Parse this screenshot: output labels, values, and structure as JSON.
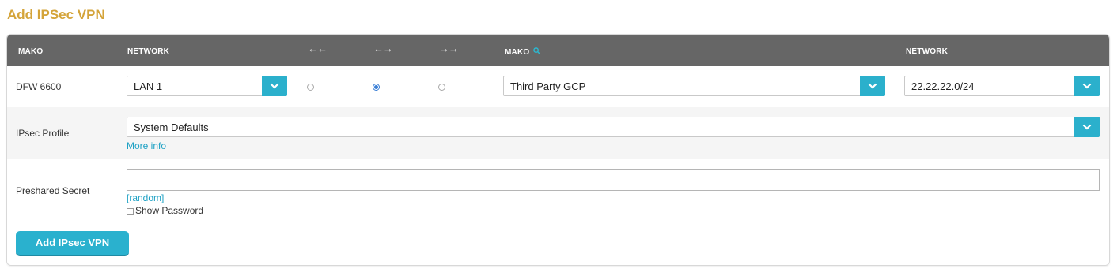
{
  "page": {
    "title": "Add IPSec VPN"
  },
  "table_header": {
    "col_mako": "MAKO",
    "col_network": "NETWORK",
    "dir_left": "←←",
    "dir_both": "←→",
    "dir_right": "→→",
    "col_remote_mako": "MAKO",
    "col_remote_network": "NETWORK",
    "icons": {
      "search": "search-icon"
    }
  },
  "tunnel_row": {
    "local_mako": "DFW 6600",
    "local_network": "LAN 1",
    "direction_selected": "both",
    "remote_mako": "Third Party GCP",
    "remote_network": "22.22.22.0/24"
  },
  "ipsec_profile": {
    "label": "IPsec Profile",
    "value": "System Defaults",
    "more_info": "More info"
  },
  "preshared_secret": {
    "label": "Preshared Secret",
    "value": "",
    "random_link": "[random]",
    "show_password_label": "Show Password",
    "show_password_checked": false
  },
  "submit_button": "Add IPsec VPN",
  "colors": {
    "title": "#d4a43a",
    "header_bg": "#666666",
    "accent": "#2bb0cc",
    "link": "#1ea1c4"
  }
}
